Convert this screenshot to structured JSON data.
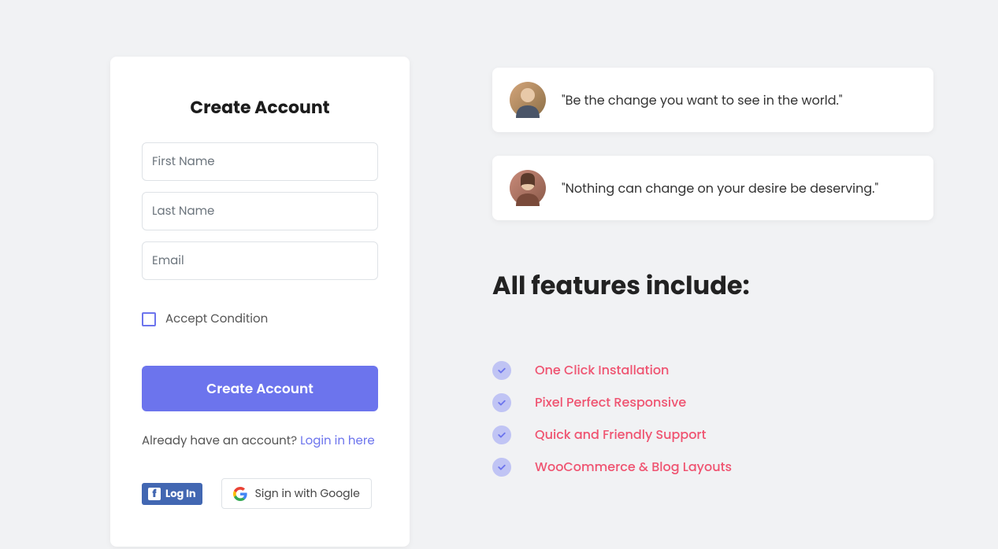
{
  "form": {
    "title": "Create Account",
    "first_name_placeholder": "First Name",
    "last_name_placeholder": "Last Name",
    "email_placeholder": "Email",
    "checkbox_label": "Accept Condition",
    "submit_label": "Create Account",
    "already_text": "Already have an account? ",
    "login_link_text": "Login in here",
    "fb_label": "Log In",
    "google_label": "Sign in with Google"
  },
  "quotes": [
    {
      "text": "\"Be the change you want to see in the world.\""
    },
    {
      "text": "\"Nothing can change on your desire be deserving.\""
    }
  ],
  "features": {
    "title": "All features include:",
    "items": [
      "One Click Installation",
      "Pixel Perfect Responsive",
      "Quick and Friendly Support",
      "WooCommerce & Blog Layouts"
    ]
  }
}
